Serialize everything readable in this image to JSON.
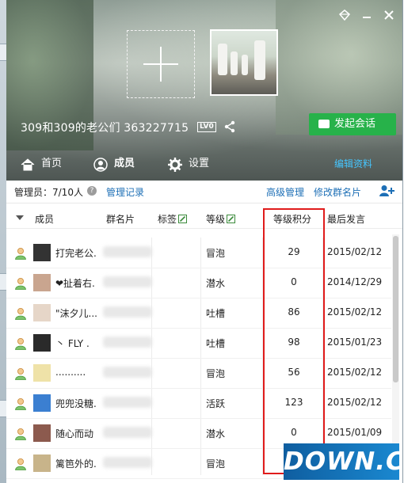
{
  "window": {
    "group_name": "309和309的老公们 363227715",
    "level_badge": "LV0",
    "start_chat_label": "发起会话",
    "top_icons": [
      "diamond-icon",
      "minimize-icon",
      "close-icon"
    ]
  },
  "tabs": [
    {
      "label": "首页",
      "icon": "home-icon",
      "active": false
    },
    {
      "label": "成员",
      "icon": "user-icon",
      "active": true
    },
    {
      "label": "设置",
      "icon": "gear-icon",
      "active": false
    }
  ],
  "tab_edit_label": "编辑资料",
  "infobar": {
    "admins": "管理员：7/10人",
    "manage_log": "管理记录",
    "advanced": "高级管理",
    "edit_card": "修改群名片"
  },
  "table": {
    "headers": {
      "member": "成员",
      "card": "群名片",
      "tag": "标签",
      "level": "等级",
      "score": "等级积分",
      "last": "最后发言"
    },
    "rows": [
      {
        "name": "打完老公.",
        "level": "冒泡",
        "score": "29",
        "last": "2015/02/12"
      },
      {
        "name": "❤扯着右.",
        "level": "潜水",
        "score": "0",
        "last": "2014/12/29"
      },
      {
        "name": "\"沫夕儿...",
        "level": "吐槽",
        "score": "86",
        "last": "2015/02/12"
      },
      {
        "name": "丶 FLY .",
        "level": "吐槽",
        "score": "98",
        "last": "2015/01/23"
      },
      {
        "name": "..........",
        "level": "冒泡",
        "score": "56",
        "last": "2015/02/12"
      },
      {
        "name": "兜兜没糖.",
        "level": "活跃",
        "score": "123",
        "last": "2015/02/12"
      },
      {
        "name": "随心而动",
        "level": "潜水",
        "score": "0",
        "last": "2015/01/09"
      },
      {
        "name": "篱笆外的.",
        "level": "冒泡",
        "score": "",
        "last": ""
      }
    ]
  },
  "watermark": "DOWN.CC",
  "colors": {
    "accent_green": "#27b24a",
    "link_blue": "#1d6fb6",
    "highlight_red": "#e01b1b",
    "tab_link": "#45c6ff"
  }
}
